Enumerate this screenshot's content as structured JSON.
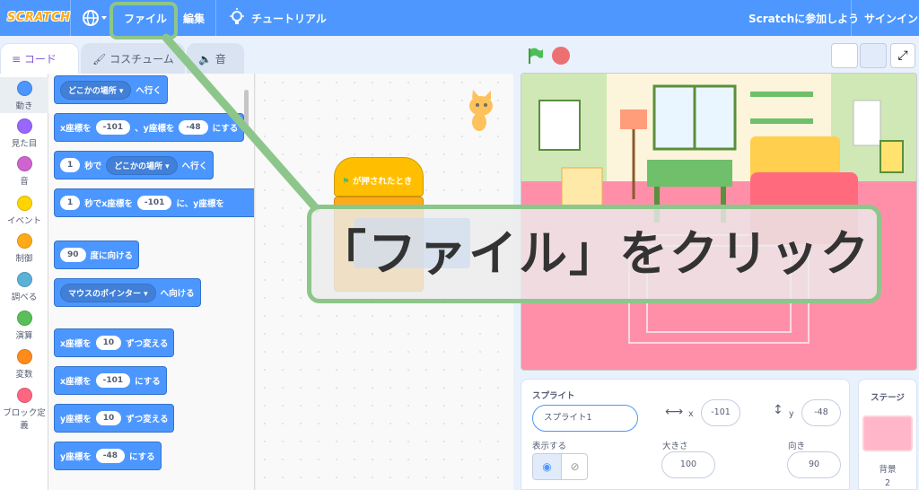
{
  "menubar": {
    "logo": "SCRATCH",
    "file": "ファイル",
    "edit": "編集",
    "tutorials": "チュートリアル",
    "join": "Scratchに参加しよう",
    "signin": "サインイン"
  },
  "tabs": {
    "code": "コード",
    "costumes": "コスチューム",
    "sounds": "音"
  },
  "categories": [
    {
      "label": "動き",
      "color": "#4c97ff"
    },
    {
      "label": "見た目",
      "color": "#9966ff"
    },
    {
      "label": "音",
      "color": "#cf63cf"
    },
    {
      "label": "イベント",
      "color": "#ffd500"
    },
    {
      "label": "制御",
      "color": "#ffab19"
    },
    {
      "label": "調べる",
      "color": "#5cb1d6"
    },
    {
      "label": "演算",
      "color": "#59c059"
    },
    {
      "label": "変数",
      "color": "#ff8c1a"
    },
    {
      "label": "ブロック定義",
      "color": "#ff6680"
    }
  ],
  "blocks": {
    "b1": {
      "dropdown": "どこかの場所",
      "text": "へ行く"
    },
    "b2": {
      "t1": "x座標を",
      "x": "-101",
      "t2": "、y座標を",
      "y": "-48",
      "t3": "にする"
    },
    "b3": {
      "secs": "1",
      "t1": "秒で",
      "dropdown": "どこかの場所",
      "t2": "へ行く"
    },
    "b4": {
      "secs": "1",
      "t1": "秒でx座標を",
      "x": "-101",
      "t2": "に、y座標を"
    },
    "b5": {
      "deg": "90",
      "text": "度に向ける"
    },
    "b6": {
      "dropdown": "マウスのポインター",
      "text": "へ向ける"
    },
    "b7": {
      "t1": "x座標を",
      "v": "10",
      "t2": "ずつ変える"
    },
    "b8": {
      "t1": "x座標を",
      "v": "-101",
      "t2": "にする"
    },
    "b9": {
      "t1": "y座標を",
      "v": "10",
      "t2": "ずつ変える"
    },
    "b10": {
      "t1": "y座標を",
      "v": "-48",
      "t2": "にする"
    }
  },
  "script": {
    "hat": "が押されたとき"
  },
  "sprite_info": {
    "sprite_label": "スプライト",
    "sprite_name": "スプライト1",
    "x_label": "x",
    "x": "-101",
    "y_label": "y",
    "y": "-48",
    "show_label": "表示する",
    "size_label": "大きさ",
    "size": "100",
    "direction_label": "向き",
    "direction": "90"
  },
  "stage_panel": {
    "title": "ステージ",
    "backdrop_label": "背景",
    "backdrop_count": "2"
  },
  "callout": {
    "text": "「ファイル」をクリック"
  },
  "colors": {
    "menubar": "#4d97ff",
    "highlight": "#8dc68a",
    "motion": "#4c97ff"
  }
}
